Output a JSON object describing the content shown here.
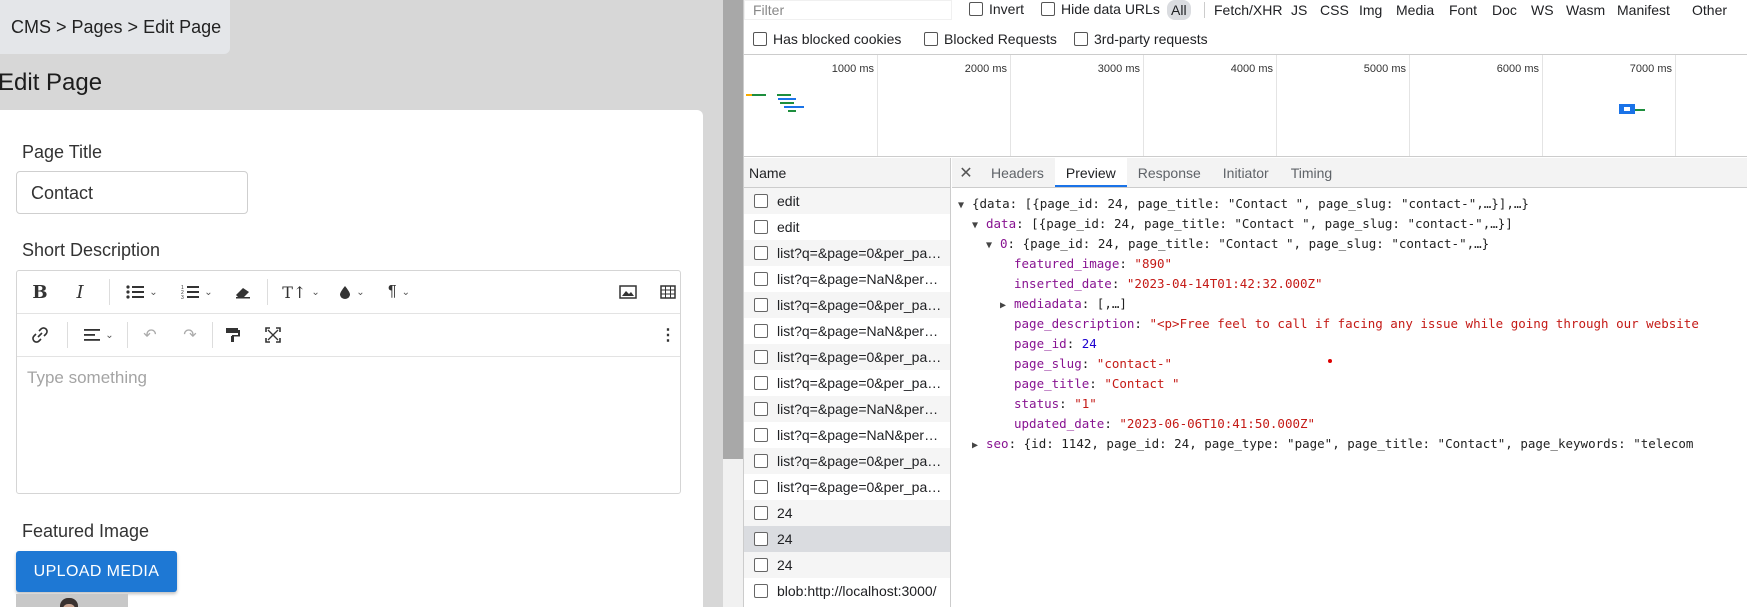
{
  "cms": {
    "breadcrumb": "CMS > Pages > Edit Page",
    "heading": "Edit Page",
    "page_title_label": "Page Title",
    "page_title_value": "Contact",
    "short_desc_label": "Short Description",
    "editor_placeholder": "Type something",
    "featured_image_label": "Featured Image",
    "upload_button": "UPLOAD MEDIA",
    "toolbar_icons": [
      "bold-icon",
      "italic-icon",
      "bulleted-list-icon",
      "numbered-list-icon",
      "eraser-icon",
      "font-size-icon",
      "ink-drop-icon",
      "paragraph-icon",
      "image-icon",
      "table-icon",
      "link-icon",
      "align-icon",
      "undo-icon",
      "redo-icon",
      "format-painter-icon",
      "fullscreen-icon",
      "more-vert-icon"
    ]
  },
  "devtools": {
    "filter_placeholder": "Filter",
    "invert": "Invert",
    "hide_data_urls": "Hide data URLs",
    "types": [
      "All",
      "Fetch/XHR",
      "JS",
      "CSS",
      "Img",
      "Media",
      "Font",
      "Doc",
      "WS",
      "Wasm",
      "Manifest",
      "Other"
    ],
    "has_blocked_cookies": "Has blocked cookies",
    "blocked_requests": "Blocked Requests",
    "third_party": "3rd-party requests",
    "timeline_ticks": [
      "1000 ms",
      "2000 ms",
      "3000 ms",
      "4000 ms",
      "5000 ms",
      "6000 ms",
      "7000 ms"
    ],
    "name_header": "Name",
    "requests": [
      "edit",
      "edit",
      "list?q=&page=0&per_page=10",
      "list?q=&page=NaN&per_page=10",
      "list?q=&page=0&per_page=10",
      "list?q=&page=NaN&per_page=10",
      "list?q=&page=0&per_page=10",
      "list?q=&page=0&per_page=10",
      "list?q=&page=NaN&per_page=10",
      "list?q=&page=NaN&per_page=10",
      "list?q=&page=0&per_page=10",
      "list?q=&page=0&per_page=10",
      "24",
      "24",
      "24",
      "blob:http://localhost:3000/"
    ],
    "selected_request_index": 13,
    "tabs": [
      "Headers",
      "Preview",
      "Response",
      "Initiator",
      "Timing"
    ],
    "active_tab": "Preview",
    "json_lines": {
      "root": "{data: [{page_id: 24, page_title: \"Contact \", page_slug: \"contact-\",…}],…}",
      "data_key": "data",
      "data_val": "[{page_id: 24, page_title: \"Contact \", page_slug: \"contact-\",…}]",
      "item0_key": "0",
      "item0_val": "{page_id: 24, page_title: \"Contact \", page_slug: \"contact-\",…}",
      "featured_image_key": "featured_image",
      "featured_image_val": "\"890\"",
      "inserted_date_key": "inserted_date",
      "inserted_date_val": "\"2023-04-14T01:42:32.000Z\"",
      "mediadata_key": "mediadata",
      "mediadata_val": "[,…]",
      "page_description_key": "page_description",
      "page_description_val": "\"<p>Free feel to call if facing any issue while going through our website",
      "page_id_key": "page_id",
      "page_id_val": "24",
      "page_slug_key": "page_slug",
      "page_slug_val": "\"contact-\"",
      "page_title_key": "page_title",
      "page_title_val": "\"Contact \"",
      "status_key": "status",
      "status_val": "\"1\"",
      "updated_date_key": "updated_date",
      "updated_date_val": "\"2023-06-06T10:41:50.000Z\"",
      "seo_key": "seo",
      "seo_val": "{id: 1142, page_id: 24, page_type: \"page\", page_title: \"Contact\", page_keywords: \"telecom"
    }
  }
}
